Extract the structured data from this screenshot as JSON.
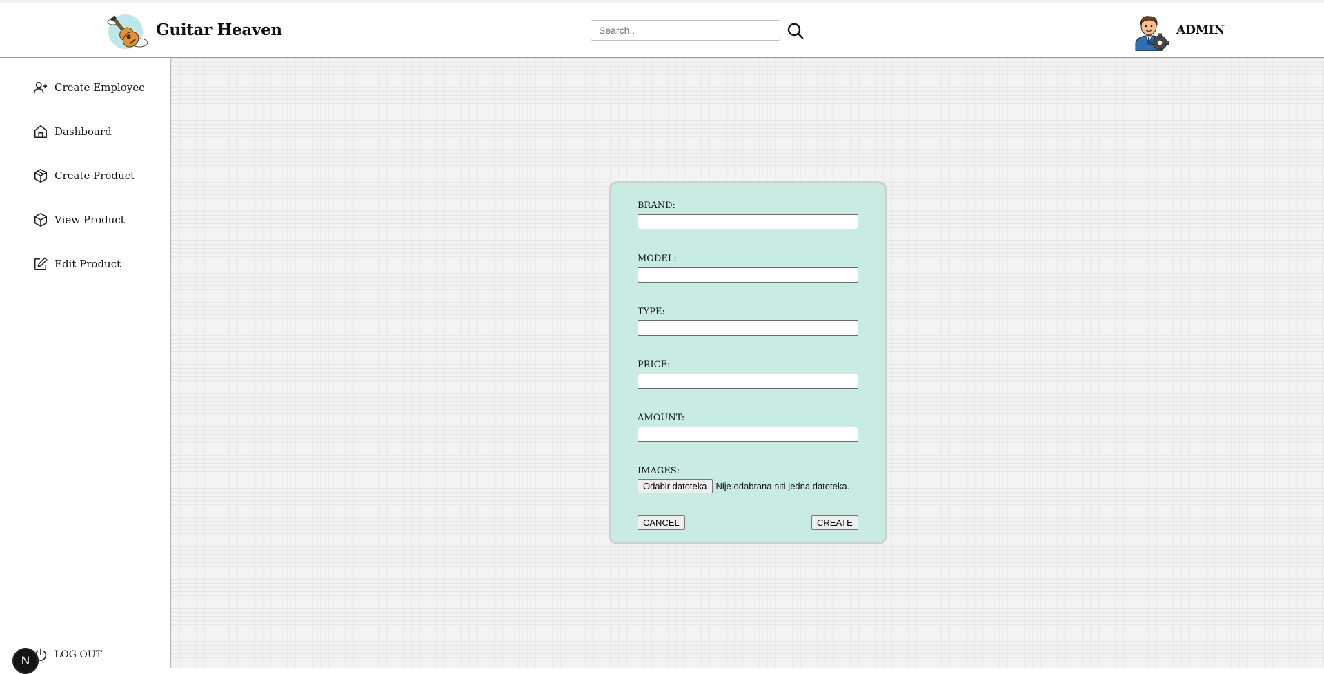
{
  "header": {
    "brand_title": "Guitar Heaven",
    "search_placeholder": "Search..",
    "admin_label": "ADMIN"
  },
  "sidebar": {
    "items": [
      {
        "label": "Create Employee",
        "icon": "user-plus-icon"
      },
      {
        "label": "Dashboard",
        "icon": "home-icon"
      },
      {
        "label": "Create Product",
        "icon": "package-icon"
      },
      {
        "label": "View Product",
        "icon": "box-icon"
      },
      {
        "label": "Edit Product",
        "icon": "edit-icon"
      }
    ],
    "logout_label": "LOG OUT",
    "badge_letter": "N"
  },
  "form": {
    "fields": [
      {
        "label": "BRAND:",
        "value": ""
      },
      {
        "label": "MODEL:",
        "value": ""
      },
      {
        "label": "TYPE:",
        "value": ""
      },
      {
        "label": "PRICE:",
        "value": ""
      },
      {
        "label": "AMOUNT:",
        "value": ""
      }
    ],
    "images_label": "IMAGES:",
    "file_button_label": "Odabir datoteka",
    "file_status": "Nije odabrana niti jedna datoteka.",
    "cancel_label": "CANCEL",
    "create_label": "CREATE"
  },
  "colors": {
    "card_background": "#c8ece3",
    "header_border": "#9a9a9a"
  }
}
